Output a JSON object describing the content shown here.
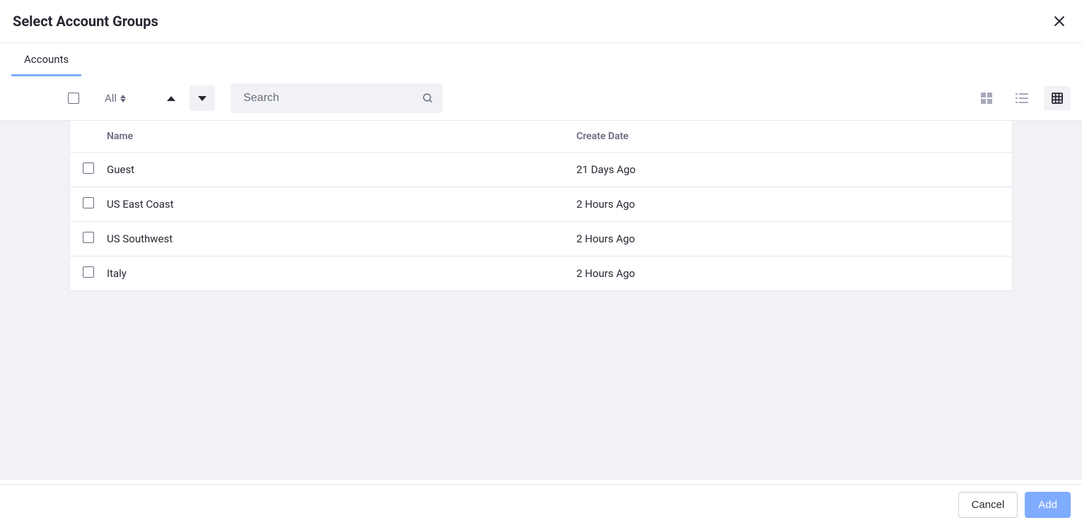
{
  "header": {
    "title": "Select Account Groups"
  },
  "tabs": [
    {
      "label": "Accounts",
      "active": true
    }
  ],
  "toolbar": {
    "filter_label": "All",
    "search_placeholder": "Search"
  },
  "table": {
    "columns": {
      "name": "Name",
      "create_date": "Create Date"
    },
    "rows": [
      {
        "name": "Guest",
        "create_date": "21 Days Ago"
      },
      {
        "name": "US East Coast",
        "create_date": "2 Hours Ago"
      },
      {
        "name": "US Southwest",
        "create_date": "2 Hours Ago"
      },
      {
        "name": "Italy",
        "create_date": "2 Hours Ago"
      }
    ]
  },
  "footer": {
    "cancel_label": "Cancel",
    "add_label": "Add"
  }
}
